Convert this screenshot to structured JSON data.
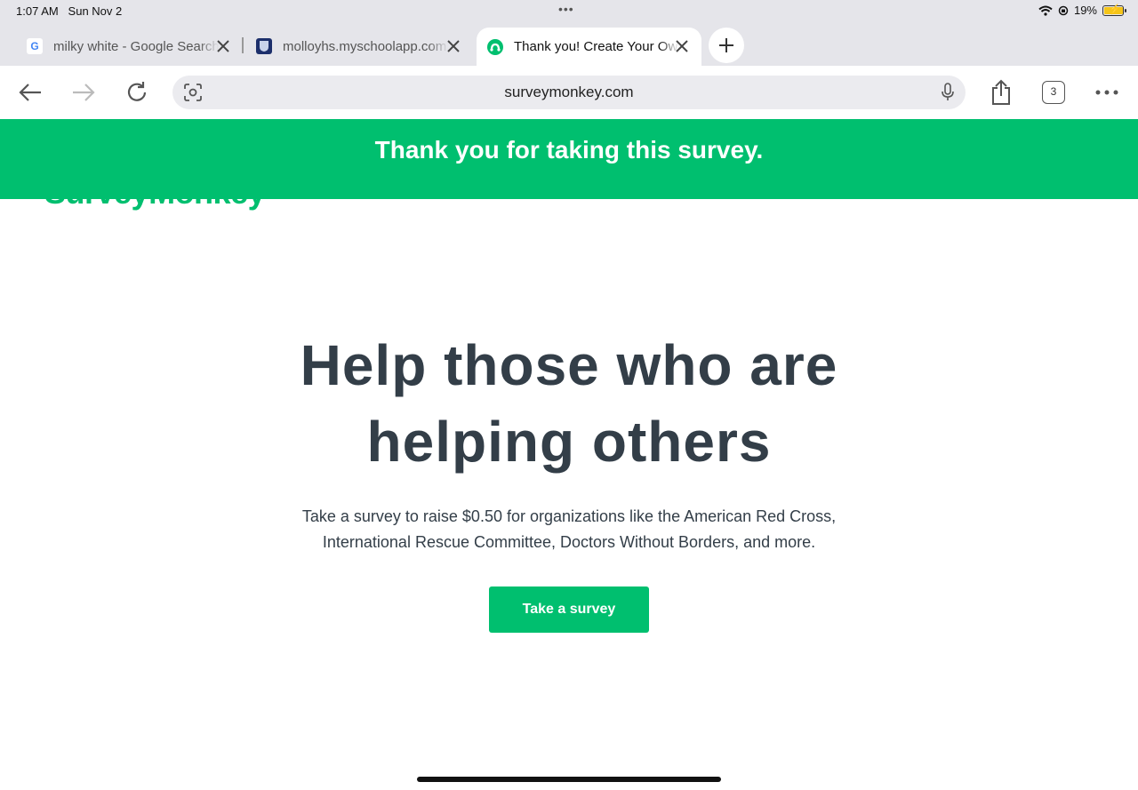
{
  "status_bar": {
    "time": "1:07 AM",
    "date": "Sun Nov 2",
    "battery": "19%",
    "icons": [
      "wifi-icon",
      "orientation-lock-icon",
      "battery-charging-icon"
    ]
  },
  "tabs": [
    {
      "title": "milky white - Google Search",
      "favicon": "G",
      "active": false
    },
    {
      "title": "molloyhs.myschoolapp.com",
      "favicon": "school-crest-icon",
      "active": false
    },
    {
      "title": "Thank you! Create Your Own Survey",
      "favicon": "surveymonkey-icon",
      "active": true
    }
  ],
  "toolbar": {
    "url": "surveymonkey.com",
    "tab_count": "3"
  },
  "page": {
    "banner": "Thank you for taking this survey.",
    "logo_text": "SurveyMonkey",
    "headline_line1": "Help those who are",
    "headline_line2": "helping others",
    "sub_line1": "Take a survey to raise $0.50 for organizations like the American Red Cross,",
    "sub_line2": "International Rescue Committee, Doctors Without Borders, and more.",
    "cta": "Take a survey"
  },
  "colors": {
    "brand_green": "#00bf6f",
    "heading": "#333e48",
    "chrome_bg": "#e5e5ea"
  }
}
